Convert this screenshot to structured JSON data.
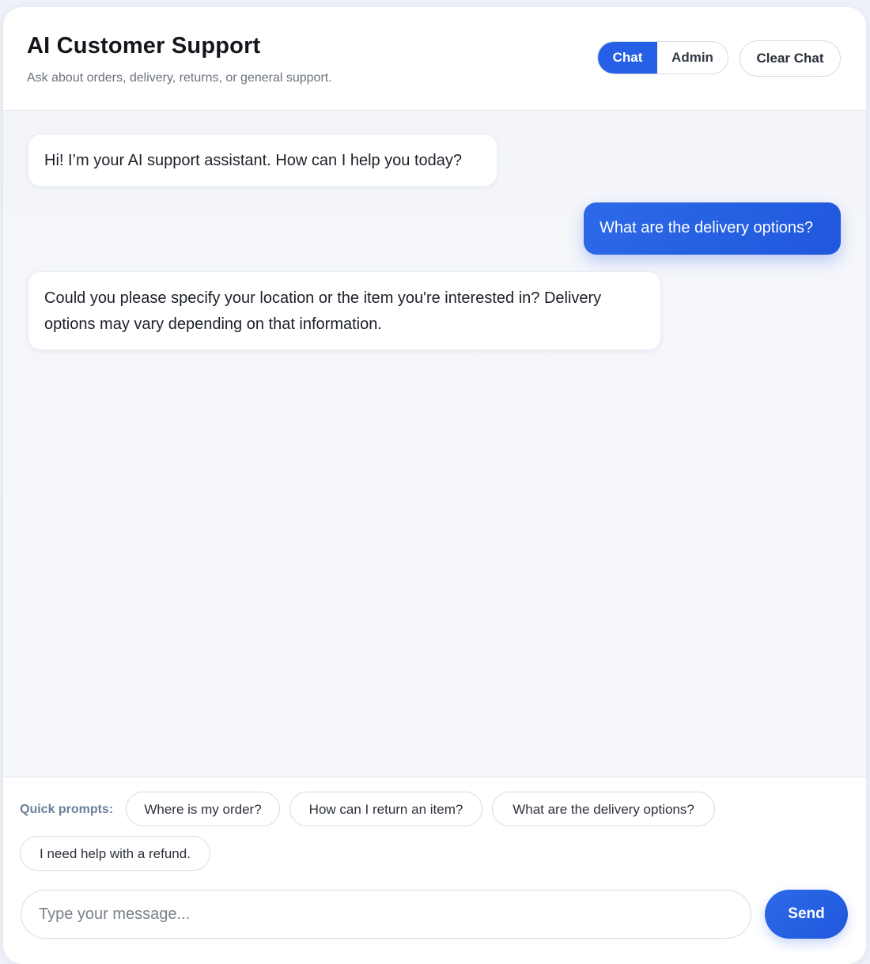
{
  "header": {
    "title": "AI Customer Support",
    "subtitle": "Ask about orders, delivery, returns, or general support.",
    "tabs": [
      {
        "label": "Chat",
        "active": true
      },
      {
        "label": "Admin",
        "active": false
      }
    ],
    "clear_label": "Clear Chat"
  },
  "messages": [
    {
      "role": "assistant",
      "text": "Hi! I’m your AI support assistant. How can I help you today?"
    },
    {
      "role": "user",
      "text": "What are the delivery options?"
    },
    {
      "role": "assistant",
      "text": "Could you please specify your location or the item you're interested in? Delivery options may vary depending on that information."
    }
  ],
  "quick_prompts": {
    "label": "Quick prompts:",
    "items": [
      "Where is my order?",
      "How can I return an item?",
      "What are the delivery options?",
      "I need help with a refund."
    ]
  },
  "composer": {
    "placeholder": "Type your message...",
    "value": "",
    "send_label": "Send"
  },
  "colors": {
    "accent": "#2660e6",
    "background": "#eef1f7",
    "chat_background": "#f3f5fa",
    "muted_text": "#6b7280"
  }
}
